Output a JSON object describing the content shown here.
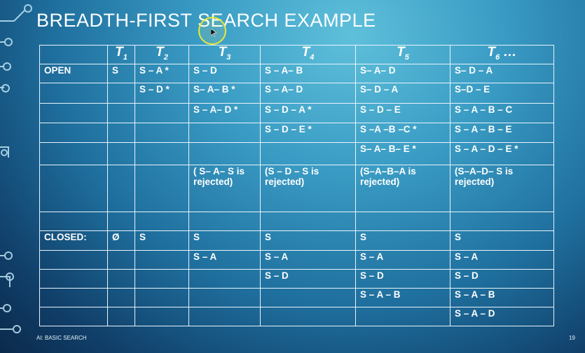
{
  "title": "BREADTH-FIRST SEARCH EXAMPLE",
  "footer": {
    "left": "AI: BASIC SEARCH",
    "page": "19"
  },
  "table": {
    "headers": [
      {
        "letter": "T",
        "sub": "1",
        "suffix": ""
      },
      {
        "letter": "T",
        "sub": "2",
        "suffix": ""
      },
      {
        "letter": "T",
        "sub": "3",
        "suffix": ""
      },
      {
        "letter": "T",
        "sub": "4",
        "suffix": ""
      },
      {
        "letter": "T",
        "sub": "5",
        "suffix": ""
      },
      {
        "letter": "T",
        "sub": "6",
        "suffix": " …"
      }
    ],
    "rows": [
      [
        "OPEN",
        "S",
        "S – A *",
        "S – D",
        "S – A– B",
        "S– A– D",
        "S– D – A"
      ],
      [
        "",
        "",
        "S – D *",
        "S– A– B *",
        "S – A– D",
        "S– D – A",
        "S–D – E"
      ],
      [
        "",
        "",
        "",
        "S – A– D *",
        "S – D – A *",
        "S – D – E",
        "S – A – B – C"
      ],
      [
        "",
        "",
        "",
        "",
        "S – D – E *",
        "S –A –B –C *",
        "S – A – B – E"
      ],
      [
        "",
        "",
        "",
        "",
        "",
        "S– A– B– E *",
        "S – A – D – E *"
      ],
      [
        "",
        "",
        "",
        "( S– A– S is rejected)",
        "(S – D – S is rejected)",
        "(S–A–B–A is rejected)",
        "(S–A–D– S is rejected)"
      ],
      [
        "",
        "",
        "",
        "",
        "",
        "",
        ""
      ],
      [
        "CLOSED:",
        "Ø",
        "S",
        "S",
        "S",
        "S",
        "S"
      ],
      [
        "",
        "",
        "",
        "S – A",
        "S – A",
        "S – A",
        "S – A"
      ],
      [
        "",
        "",
        "",
        "",
        "S – D",
        "S – D",
        "S – D"
      ],
      [
        "",
        "",
        "",
        "",
        "",
        "S – A – B",
        "S – A – B"
      ],
      [
        "",
        "",
        "",
        "",
        "",
        "",
        "S – A – D"
      ]
    ]
  }
}
